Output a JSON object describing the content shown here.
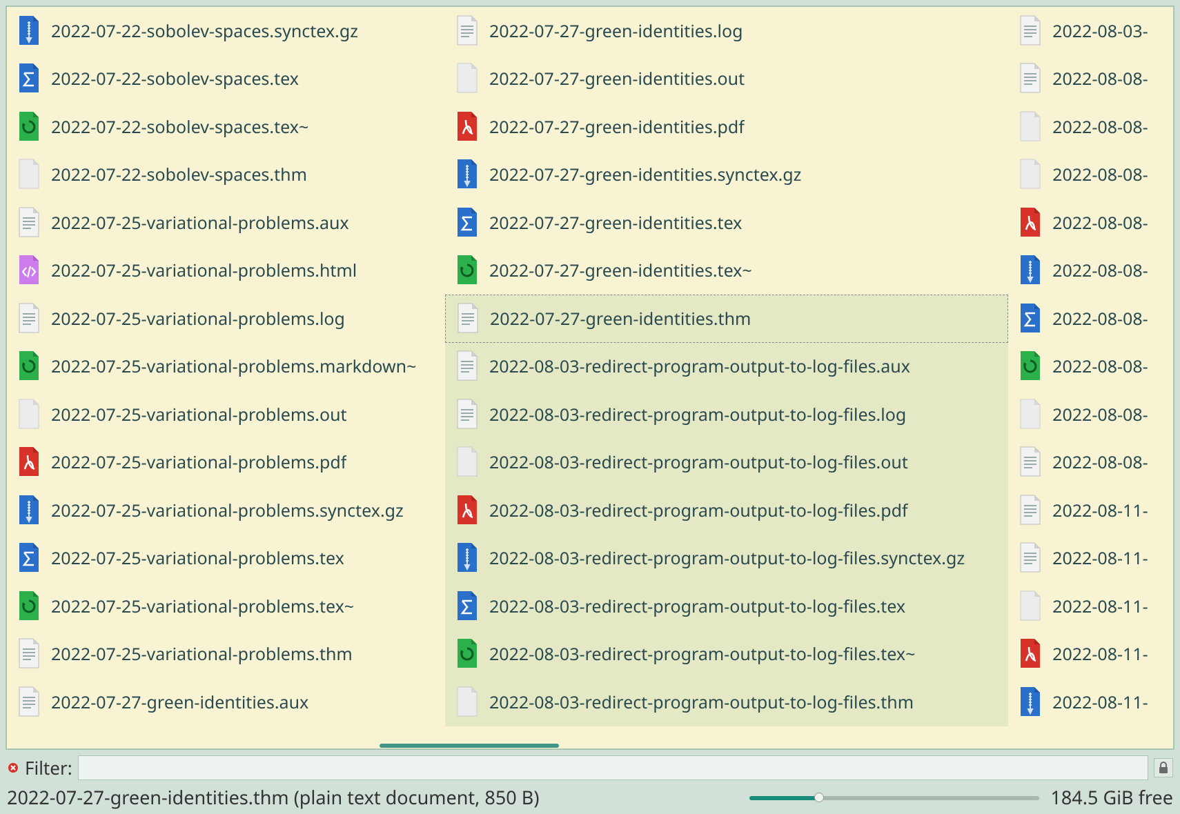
{
  "columns": [
    [
      {
        "name": "2022-07-22-sobolev-spaces.synctex.gz",
        "type": "gz",
        "sel": false
      },
      {
        "name": "2022-07-22-sobolev-spaces.tex",
        "type": "tex",
        "sel": false
      },
      {
        "name": "2022-07-22-sobolev-spaces.tex~",
        "type": "backup",
        "sel": false
      },
      {
        "name": "2022-07-22-sobolev-spaces.thm",
        "type": "blank",
        "sel": false
      },
      {
        "name": "2022-07-25-variational-problems.aux",
        "type": "txt",
        "sel": false
      },
      {
        "name": "2022-07-25-variational-problems.html",
        "type": "html",
        "sel": false
      },
      {
        "name": "2022-07-25-variational-problems.log",
        "type": "txt",
        "sel": false
      },
      {
        "name": "2022-07-25-variational-problems.markdown~",
        "type": "backup",
        "sel": false
      },
      {
        "name": "2022-07-25-variational-problems.out",
        "type": "blank",
        "sel": false
      },
      {
        "name": "2022-07-25-variational-problems.pdf",
        "type": "pdf",
        "sel": false
      },
      {
        "name": "2022-07-25-variational-problems.synctex.gz",
        "type": "gz",
        "sel": false
      },
      {
        "name": "2022-07-25-variational-problems.tex",
        "type": "tex",
        "sel": false
      },
      {
        "name": "2022-07-25-variational-problems.tex~",
        "type": "backup",
        "sel": false
      },
      {
        "name": "2022-07-25-variational-problems.thm",
        "type": "txt",
        "sel": false
      },
      {
        "name": "2022-07-27-green-identities.aux",
        "type": "txt",
        "sel": false
      }
    ],
    [
      {
        "name": "2022-07-27-green-identities.log",
        "type": "txt",
        "sel": false
      },
      {
        "name": "2022-07-27-green-identities.out",
        "type": "blank",
        "sel": false
      },
      {
        "name": "2022-07-27-green-identities.pdf",
        "type": "pdf",
        "sel": false
      },
      {
        "name": "2022-07-27-green-identities.synctex.gz",
        "type": "gz",
        "sel": false
      },
      {
        "name": "2022-07-27-green-identities.tex",
        "type": "tex",
        "sel": false
      },
      {
        "name": "2022-07-27-green-identities.tex~",
        "type": "backup",
        "sel": false
      },
      {
        "name": "2022-07-27-green-identities.thm",
        "type": "txt",
        "sel": false,
        "focused": true
      },
      {
        "name": "2022-08-03-redirect-program-output-to-log-files.aux",
        "type": "txt",
        "sel": true
      },
      {
        "name": "2022-08-03-redirect-program-output-to-log-files.log",
        "type": "txt",
        "sel": true
      },
      {
        "name": "2022-08-03-redirect-program-output-to-log-files.out",
        "type": "blank",
        "sel": true
      },
      {
        "name": "2022-08-03-redirect-program-output-to-log-files.pdf",
        "type": "pdf",
        "sel": true
      },
      {
        "name": "2022-08-03-redirect-program-output-to-log-files.synctex.gz",
        "type": "gz",
        "sel": true
      },
      {
        "name": "2022-08-03-redirect-program-output-to-log-files.tex",
        "type": "tex",
        "sel": true
      },
      {
        "name": "2022-08-03-redirect-program-output-to-log-files.tex~",
        "type": "backup",
        "sel": true
      },
      {
        "name": "2022-08-03-redirect-program-output-to-log-files.thm",
        "type": "blank",
        "sel": true
      }
    ],
    [
      {
        "name": "2022-08-03-",
        "type": "txt",
        "sel": false
      },
      {
        "name": "2022-08-08-",
        "type": "txt",
        "sel": false
      },
      {
        "name": "2022-08-08-",
        "type": "blank",
        "sel": false
      },
      {
        "name": "2022-08-08-",
        "type": "blank",
        "sel": false
      },
      {
        "name": "2022-08-08-",
        "type": "pdf",
        "sel": false
      },
      {
        "name": "2022-08-08-",
        "type": "gz",
        "sel": false
      },
      {
        "name": "2022-08-08-",
        "type": "tex",
        "sel": false
      },
      {
        "name": "2022-08-08-",
        "type": "backup",
        "sel": false
      },
      {
        "name": "2022-08-08-",
        "type": "blank",
        "sel": false
      },
      {
        "name": "2022-08-08-",
        "type": "txt",
        "sel": false
      },
      {
        "name": "2022-08-11-",
        "type": "txt",
        "sel": false
      },
      {
        "name": "2022-08-11-",
        "type": "txt",
        "sel": false
      },
      {
        "name": "2022-08-11-",
        "type": "blank",
        "sel": false
      },
      {
        "name": "2022-08-11-",
        "type": "pdf",
        "sel": false
      },
      {
        "name": "2022-08-11-",
        "type": "gz",
        "sel": false
      }
    ]
  ],
  "filter": {
    "label": "Filter:",
    "value": ""
  },
  "status": {
    "selection": "2022-07-27-green-identities.thm (plain text document, 850 B)",
    "freespace": "184.5 GiB free"
  }
}
